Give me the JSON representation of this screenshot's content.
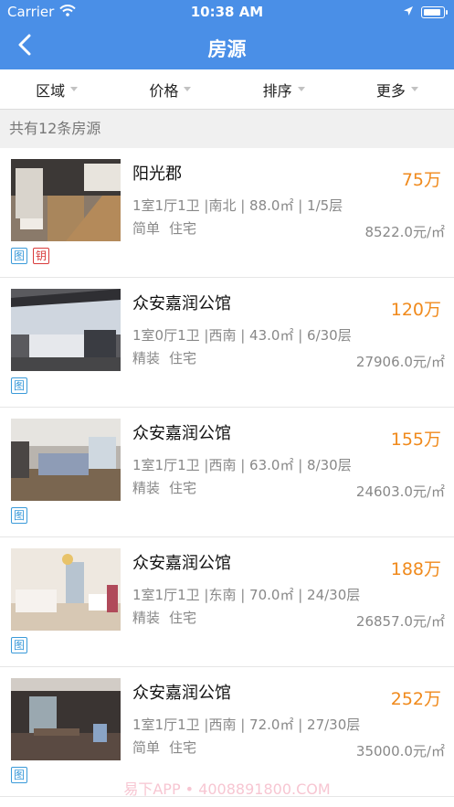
{
  "status": {
    "carrier": "Carrier",
    "time": "10:38 AM"
  },
  "nav": {
    "title": "房源"
  },
  "filters": [
    "区域",
    "价格",
    "排序",
    "更多"
  ],
  "count_text": "共有12条房源",
  "listings": [
    {
      "name": "阳光郡",
      "price": "75万",
      "specs": "1室1厅1卫 |南北 | 88.0㎡ | 1/5层",
      "decoration": "简单",
      "usage": "住宅",
      "unit_price": "8522.0元/㎡",
      "tags": [
        "图",
        "钥"
      ]
    },
    {
      "name": "众安嘉润公馆",
      "price": "120万",
      "specs": "1室0厅1卫 |西南 | 43.0㎡ | 6/30层",
      "decoration": "精装",
      "usage": "住宅",
      "unit_price": "27906.0元/㎡",
      "tags": [
        "图"
      ]
    },
    {
      "name": "众安嘉润公馆",
      "price": "155万",
      "specs": "1室1厅1卫 |西南 | 63.0㎡ | 8/30层",
      "decoration": "精装",
      "usage": "住宅",
      "unit_price": "24603.0元/㎡",
      "tags": [
        "图"
      ]
    },
    {
      "name": "众安嘉润公馆",
      "price": "188万",
      "specs": "1室1厅1卫 |东南 | 70.0㎡ | 24/30层",
      "decoration": "精装",
      "usage": "住宅",
      "unit_price": "26857.0元/㎡",
      "tags": [
        "图"
      ]
    },
    {
      "name": "众安嘉润公馆",
      "price": "252万",
      "specs": "1室1厅1卫 |西南 | 72.0㎡ | 27/30层",
      "decoration": "简单",
      "usage": "住宅",
      "unit_price": "35000.0元/㎡",
      "tags": [
        "图"
      ]
    }
  ],
  "watermark": "易下APP • 4008891800.COM",
  "colors": {
    "header": "#4a8fe7",
    "price": "#f08a1c",
    "tag_pic": "#3a9ad9",
    "tag_key": "#d83a3a"
  }
}
